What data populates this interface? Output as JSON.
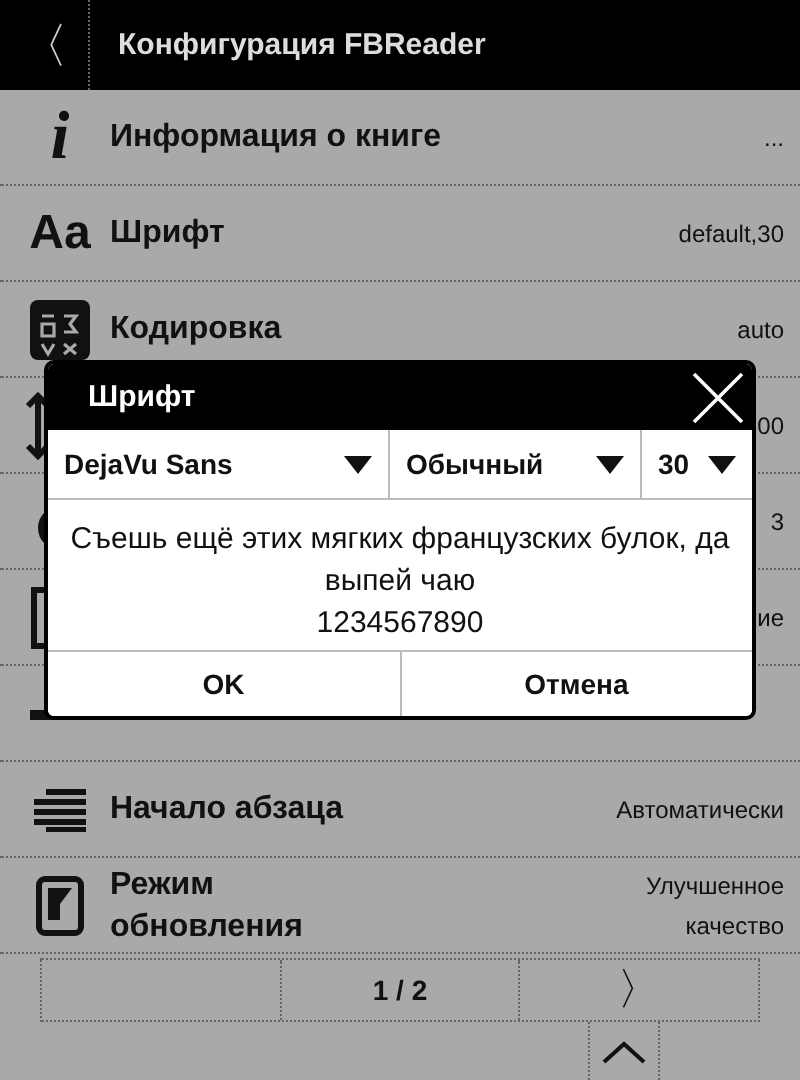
{
  "header": {
    "back": "〈",
    "title": "Конфигурация FBReader"
  },
  "rows": [
    {
      "icon_text": "i",
      "label": "Информация о книге",
      "value": "..."
    },
    {
      "icon_text": "Aa",
      "label": "Шрифт",
      "value": "default,30"
    },
    {
      "label": "Кодировка",
      "value": "auto"
    },
    {
      "value": "00"
    },
    {
      "value": "3"
    },
    {
      "value": "ие"
    },
    {},
    {
      "label": "Начало абзаца",
      "value": "Автоматически"
    },
    {
      "label": "Режим обновления",
      "value": "Улучшенное качество"
    }
  ],
  "pager": {
    "page": "1 / 2",
    "next": "〉"
  },
  "dialog": {
    "title": "Шрифт",
    "dropdowns": [
      {
        "value": "DejaVu Sans"
      },
      {
        "value": "Обычный"
      },
      {
        "value": "30"
      }
    ],
    "sample": "Съешь ещё этих мягких французских булок, да выпей чаю",
    "digits": "1234567890",
    "buttons": [
      "OK",
      "Отмена"
    ]
  }
}
